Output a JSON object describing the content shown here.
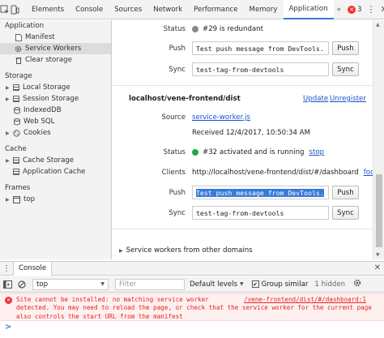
{
  "toolbar": {
    "tabs": [
      "Elements",
      "Console",
      "Sources",
      "Network",
      "Performance",
      "Memory",
      "Application"
    ],
    "active_tab": "Application",
    "more": "»",
    "error_count": "3",
    "accent": "#3879d9"
  },
  "sidebar": {
    "application_title": "Application",
    "application_items": [
      "Manifest",
      "Service Workers",
      "Clear storage"
    ],
    "selected": "Service Workers",
    "storage_title": "Storage",
    "storage_items": [
      "Local Storage",
      "Session Storage",
      "IndexedDB",
      "Web SQL",
      "Cookies"
    ],
    "cache_title": "Cache",
    "cache_items": [
      "Cache Storage",
      "Application Cache"
    ],
    "frames_title": "Frames",
    "frames_items": [
      "top"
    ]
  },
  "main": {
    "prev": {
      "status_label": "Status",
      "status_text": "#29 is redundant",
      "status_color": "#888888",
      "push_label": "Push",
      "push_value": "Test push message from DevTools.",
      "push_button": "Push",
      "sync_label": "Sync",
      "sync_value": "test-tag-from-devtools",
      "sync_button": "Sync"
    },
    "worker": {
      "origin": "localhost/vene-frontend/dist",
      "update_link": "Update",
      "unregister_link": "Unregister",
      "source_label": "Source",
      "source_link": "service-worker.js",
      "received": "Received 12/4/2017, 10:50:34 AM",
      "status_label": "Status",
      "status_text": "#32 activated and is running",
      "status_color": "#27a34a",
      "stop_link": "stop",
      "clients_label": "Clients",
      "clients_url": "http://localhost/vene-frontend/dist/#/dashboard",
      "focus_link": "focus",
      "push_label": "Push",
      "push_value": "Test push message from DevTools.",
      "push_button": "Push",
      "sync_label": "Sync",
      "sync_value": "test-tag-from-devtools",
      "sync_button": "Sync"
    },
    "other_domains": "Service workers from other domains"
  },
  "drawer": {
    "tab": "Console",
    "context": "top",
    "filter_placeholder": "Filter",
    "levels": "Default levels",
    "group_similar": "Group similar",
    "hidden": "1 hidden",
    "message": "Site cannot be installed: no matching service worker\ndetected. You may need to reload the page, or check that the service worker for the current page\nalso controls the start URL from the manifest",
    "message_source": "/vene-frontend/dist/#/dashboard:1",
    "prompt": ">"
  }
}
